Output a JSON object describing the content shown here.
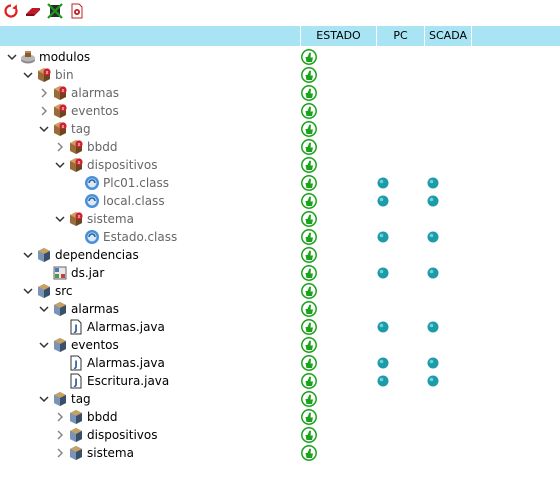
{
  "toolbar": {
    "buttons": [
      {
        "name": "refresh-icon",
        "color": "#e02020"
      },
      {
        "name": "eraser-icon",
        "color": "#c0182a"
      },
      {
        "name": "cross-out-icon",
        "color": "#1a7a1a"
      },
      {
        "name": "pdf-document-icon",
        "color": "#c02020"
      }
    ]
  },
  "columns": {
    "estado": "ESTADO",
    "pc": "PC",
    "scada": "SCADA"
  },
  "colors": {
    "header_bg": "#a9e4f5",
    "status_ok": "#1aa31a",
    "dot": "#1c9ba8"
  },
  "tree": [
    {
      "label": "modulos",
      "depth": 0,
      "expander": "open",
      "icon": "root-module-icon",
      "style": "black",
      "pc": false,
      "scada": false
    },
    {
      "label": "bin",
      "depth": 1,
      "expander": "open",
      "icon": "bin-package-icon",
      "style": "gray",
      "pc": false,
      "scada": false
    },
    {
      "label": "alarmas",
      "depth": 2,
      "expander": "closed",
      "icon": "bin-package-icon",
      "style": "gray",
      "pc": false,
      "scada": false
    },
    {
      "label": "eventos",
      "depth": 2,
      "expander": "closed",
      "icon": "bin-package-icon",
      "style": "gray",
      "pc": false,
      "scada": false
    },
    {
      "label": "tag",
      "depth": 2,
      "expander": "open",
      "icon": "bin-package-icon",
      "style": "gray",
      "pc": false,
      "scada": false
    },
    {
      "label": "bbdd",
      "depth": 3,
      "expander": "closed",
      "icon": "bin-package-icon",
      "style": "gray",
      "pc": false,
      "scada": false
    },
    {
      "label": "dispositivos",
      "depth": 3,
      "expander": "open",
      "icon": "bin-package-icon",
      "style": "gray",
      "pc": false,
      "scada": false
    },
    {
      "label": "Plc01.class",
      "depth": 4,
      "expander": "none",
      "icon": "class-file-icon",
      "style": "gray",
      "pc": true,
      "scada": true
    },
    {
      "label": "local.class",
      "depth": 4,
      "expander": "none",
      "icon": "class-file-icon",
      "style": "gray",
      "pc": true,
      "scada": true
    },
    {
      "label": "sistema",
      "depth": 3,
      "expander": "open",
      "icon": "bin-package-icon",
      "style": "gray",
      "pc": false,
      "scada": false
    },
    {
      "label": "Estado.class",
      "depth": 4,
      "expander": "none",
      "icon": "class-file-icon",
      "style": "gray",
      "pc": true,
      "scada": true
    },
    {
      "label": "dependencias",
      "depth": 1,
      "expander": "open",
      "icon": "package-icon",
      "style": "black",
      "pc": false,
      "scada": false
    },
    {
      "label": "ds.jar",
      "depth": 2,
      "expander": "none",
      "icon": "jar-file-icon",
      "style": "black",
      "pc": true,
      "scada": true
    },
    {
      "label": "src",
      "depth": 1,
      "expander": "open",
      "icon": "package-icon",
      "style": "black",
      "pc": false,
      "scada": false
    },
    {
      "label": "alarmas",
      "depth": 2,
      "expander": "open",
      "icon": "package-icon",
      "style": "black",
      "pc": false,
      "scada": false
    },
    {
      "label": "Alarmas.java",
      "depth": 3,
      "expander": "none",
      "icon": "java-file-icon",
      "style": "black",
      "pc": true,
      "scada": true
    },
    {
      "label": "eventos",
      "depth": 2,
      "expander": "open",
      "icon": "package-icon",
      "style": "black",
      "pc": false,
      "scada": false
    },
    {
      "label": "Alarmas.java",
      "depth": 3,
      "expander": "none",
      "icon": "java-file-icon",
      "style": "black",
      "pc": true,
      "scada": true
    },
    {
      "label": "Escritura.java",
      "depth": 3,
      "expander": "none",
      "icon": "java-file-icon",
      "style": "black",
      "pc": true,
      "scada": true
    },
    {
      "label": "tag",
      "depth": 2,
      "expander": "open",
      "icon": "package-icon",
      "style": "black",
      "pc": false,
      "scada": false
    },
    {
      "label": "bbdd",
      "depth": 3,
      "expander": "closed",
      "icon": "package-icon",
      "style": "black",
      "pc": false,
      "scada": false
    },
    {
      "label": "dispositivos",
      "depth": 3,
      "expander": "closed",
      "icon": "package-icon",
      "style": "black",
      "pc": false,
      "scada": false
    },
    {
      "label": "sistema",
      "depth": 3,
      "expander": "closed",
      "icon": "package-icon",
      "style": "black",
      "pc": false,
      "scada": false
    }
  ]
}
